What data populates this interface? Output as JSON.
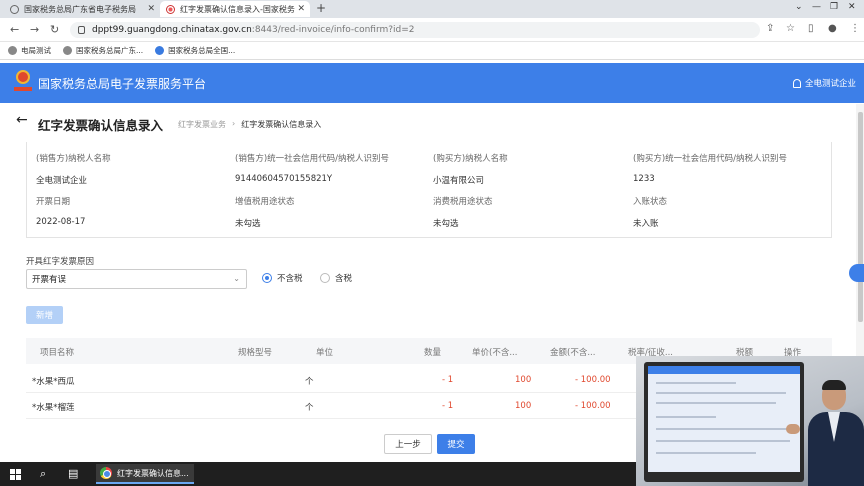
{
  "browser": {
    "tabs": [
      {
        "title": "国家税务总局广东省电子税务局"
      },
      {
        "title": "红字发票确认信息录入-国家税务"
      }
    ],
    "url_host": "dppt99.guangdong.chinatax.gov.cn",
    "url_path": ":8443/red-invoice/info-confirm?id=2",
    "bookmarks": [
      "电局测试",
      "国家税务总局广东...",
      "国家税务总局全国..."
    ]
  },
  "app": {
    "title": "国家税务总局电子发票服务平台",
    "user": "全电测试企业"
  },
  "page": {
    "title": "红字发票确认信息录入",
    "breadcrumb": [
      "红字发票业务",
      "红字发票确认信息录入"
    ]
  },
  "info": {
    "seller_name_label": "(销售方)纳税人名称",
    "seller_name": "全电测试企业",
    "seller_id_label": "(销售方)统一社会信用代码/纳税人识别号",
    "seller_id": "91440604570155821Y",
    "buyer_name_label": "(购买方)纳税人名称",
    "buyer_name": "小温有限公司",
    "buyer_id_label": "(购买方)统一社会信用代码/纳税人识别号",
    "buyer_id": "1233",
    "issue_date_label": "开票日期",
    "issue_date": "2022-08-17",
    "vat_status_label": "增值税用途状态",
    "vat_status": "未勾选",
    "consumption_status_label": "消费税用途状态",
    "consumption_status": "未勾选",
    "entry_status_label": "入账状态",
    "entry_status": "未入账"
  },
  "reason": {
    "label": "开具红字发票原因",
    "selected": "开票有误",
    "tax_excluded": "不含税",
    "tax_included": "含税"
  },
  "actions": {
    "add": "新增",
    "prev": "上一步",
    "submit": "提交"
  },
  "table": {
    "headers": [
      "项目名称",
      "规格型号",
      "单位",
      "数量",
      "单价(不含...",
      "金额(不含...",
      "税率/征收...",
      "税额",
      "操作"
    ],
    "rows": [
      {
        "name": "*水果*西瓜",
        "unit": "个",
        "qty": "- 1",
        "price": "100",
        "amount": "- 100.00"
      },
      {
        "name": "*水果*榴莲",
        "unit": "个",
        "qty": "- 1",
        "price": "100",
        "amount": "- 100.00"
      }
    ]
  },
  "taskbar": {
    "active_app": "红字发票确认信息..."
  },
  "colors": {
    "brand_blue": "#3d7fe8",
    "negative_red": "#e0482e"
  }
}
